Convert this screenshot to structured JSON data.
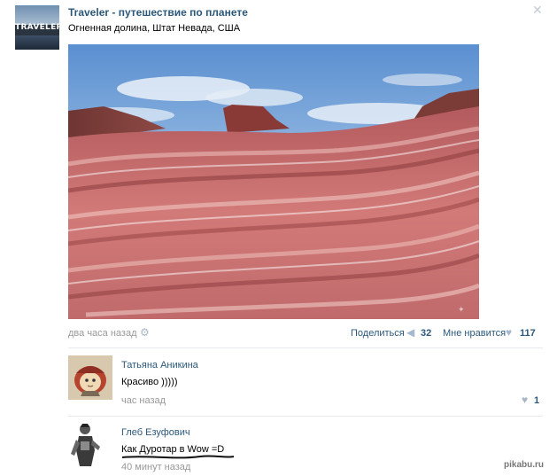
{
  "post": {
    "author": "Traveler - путешествие по планете",
    "avatar_logo": "TRAVELER",
    "text": "Огненная долина, Штат Невада, США",
    "time": "два часа назад",
    "share_label": "Поделиться",
    "share_count": "32",
    "like_label": "Мне нравится",
    "like_count": "117"
  },
  "icons": {
    "close": "close-icon",
    "settings": "gear-icon",
    "share": "megaphone-icon",
    "like": "heart-icon"
  },
  "comments": [
    {
      "author": "Татьяна Аникина",
      "text": "Красиво )))))",
      "time": "час назад",
      "like_count": "1"
    },
    {
      "author": "Глеб Езуфович",
      "text": "Как Дуротар в Wow =D",
      "time": "40 минут назад"
    }
  ],
  "watermark": "pikabu.ru",
  "colors": {
    "link": "#2b587a",
    "muted": "#999999",
    "icon": "#a6b8cc"
  }
}
